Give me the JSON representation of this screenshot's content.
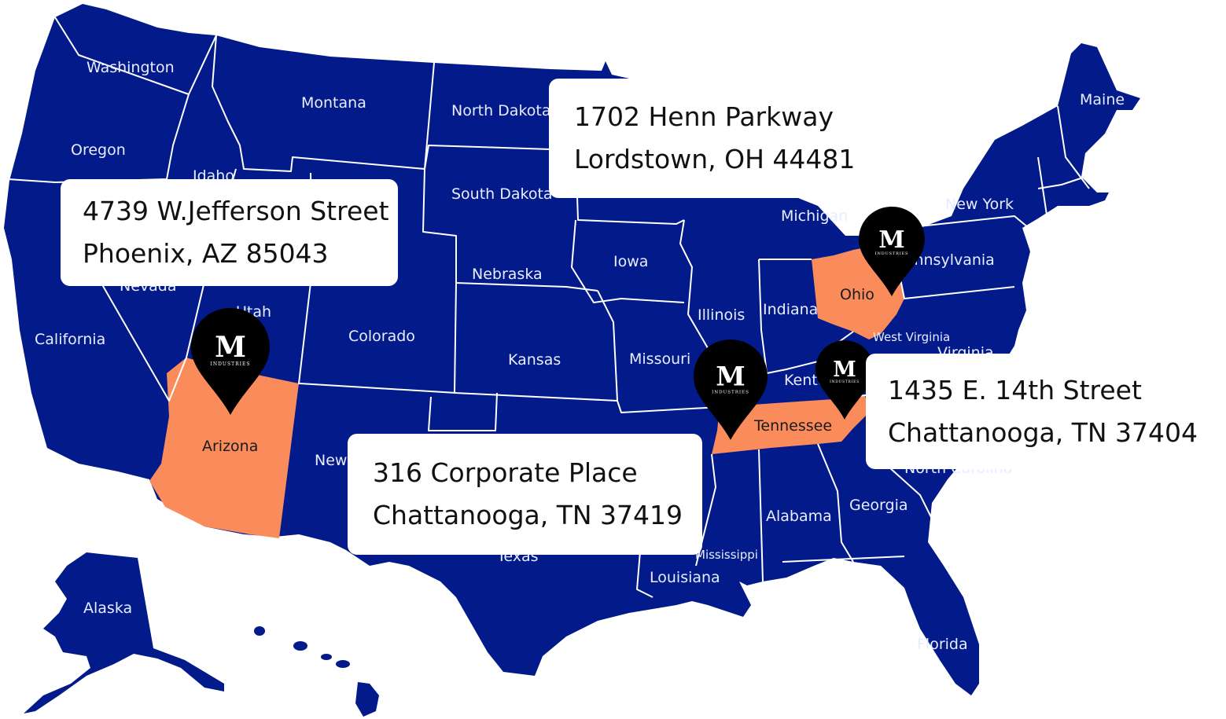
{
  "colors": {
    "land": "#021a8a",
    "highlight": "#fa8c5c",
    "border": "#ffffff",
    "pin": "#000000",
    "card": "#ffffff"
  },
  "states": {
    "washington": "Washington",
    "oregon": "Oregon",
    "idaho": "Idaho",
    "montana": "Montana",
    "north_dakota": "North Dakota",
    "south_dakota": "South Dakota",
    "nevada": "Nevada",
    "utah": "Utah",
    "california": "California",
    "colorado": "Colorado",
    "nebraska": "Nebraska",
    "kansas": "Kansas",
    "arizona": "Arizona",
    "new_mexico": "New Mexico",
    "texas": "Texas",
    "iowa": "Iowa",
    "missouri": "Missouri",
    "illinois": "Illinois",
    "indiana": "Indiana",
    "michigan": "Michigan",
    "ohio": "Ohio",
    "kentucky": "Kentucky",
    "tennessee": "Tennessee",
    "west_virginia": "West Virginia",
    "virginia": "Virginia",
    "new_york": "New York",
    "pennsylvania": "Pennsylvania",
    "maine": "Maine",
    "north_carolina": "North Carolina",
    "georgia": "Georgia",
    "alabama": "Alabama",
    "mississippi": "Mississippi",
    "louisiana": "Louisiana",
    "florida": "Florida",
    "alaska": "Alaska"
  },
  "highlighted_states": [
    "Arizona",
    "Ohio",
    "Tennessee"
  ],
  "pin_logo": {
    "monogram": "M",
    "caption": "INDUSTRIES"
  },
  "locations": [
    {
      "line1": "4739 W.Jefferson Street",
      "line2": "Phoenix, AZ 85043"
    },
    {
      "line1": "1702 Henn Parkway",
      "line2": "Lordstown, OH 44481"
    },
    {
      "line1": "316 Corporate Place",
      "line2": "Chattanooga, TN 37419"
    },
    {
      "line1": "1435 E. 14th Street",
      "line2": "Chattanooga, TN 37404"
    }
  ]
}
